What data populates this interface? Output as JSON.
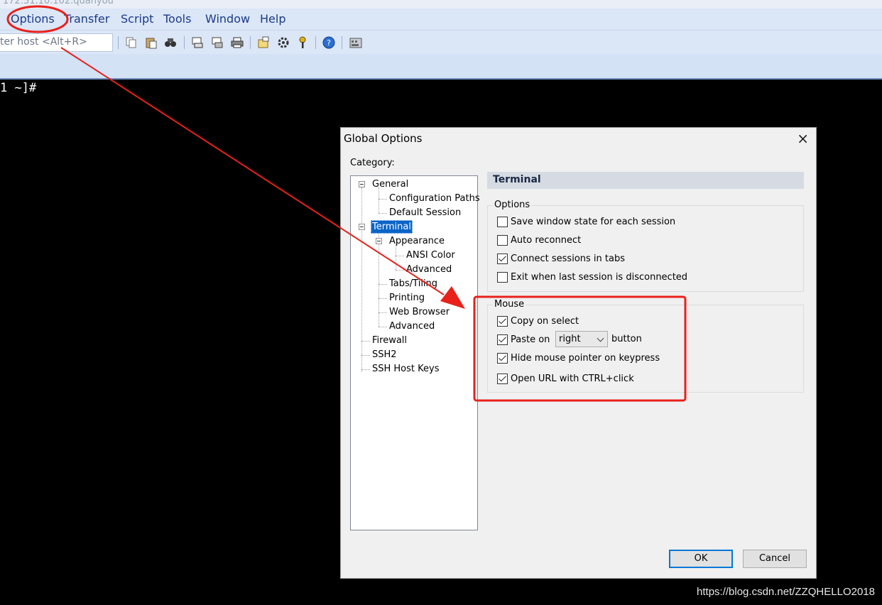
{
  "window": {
    "title_partial": "172.31.10.102.quanyou"
  },
  "menu": {
    "items": [
      "Options",
      "Transfer",
      "Script",
      "Tools",
      "Window",
      "Help"
    ]
  },
  "toolbar": {
    "host_placeholder": "ter host <Alt+R>"
  },
  "terminal": {
    "prompt": "1 ~]#"
  },
  "dialog": {
    "title": "Global Options",
    "close_glyph": "×",
    "category_label": "Category:",
    "tree": [
      "General",
      "Configuration Paths",
      "Default Session",
      "Terminal",
      "Appearance",
      "ANSI Color",
      "Advanced",
      "Tabs/Tiling",
      "Printing",
      "Web Browser",
      "Advanced",
      "Firewall",
      "SSH2",
      "SSH Host Keys"
    ],
    "selected": "Terminal",
    "section_title": "Terminal",
    "options_group": {
      "label": "Options",
      "items": [
        {
          "label": "Save window state for each session",
          "checked": false
        },
        {
          "label": "Auto reconnect",
          "checked": false
        },
        {
          "label": "Connect sessions in tabs",
          "checked": true
        },
        {
          "label": "Exit when last session is disconnected",
          "checked": false
        }
      ]
    },
    "mouse_group": {
      "label": "Mouse",
      "copy_on_select": {
        "label": "Copy on select",
        "checked": true
      },
      "paste_on": {
        "label": "Paste on",
        "checked": true,
        "value": "right",
        "suffix": "button"
      },
      "hide_pointer": {
        "label": "Hide mouse pointer on keypress",
        "checked": true
      },
      "open_url": {
        "label": "Open URL with CTRL+click",
        "checked": true
      }
    },
    "buttons": {
      "ok": "OK",
      "cancel": "Cancel"
    }
  },
  "watermark": "https://blog.csdn.net/ZZQHELLO2018",
  "annotation_color": "#e8211b"
}
